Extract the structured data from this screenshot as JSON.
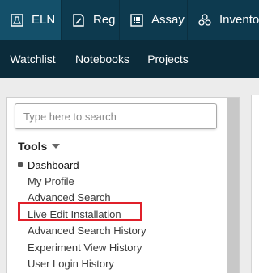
{
  "top_nav": {
    "tabs": [
      {
        "label": "ELN",
        "icon": "flask-book-icon",
        "active": true
      },
      {
        "label": "Reg",
        "icon": "register-pen-icon"
      },
      {
        "label": "Assay",
        "icon": "calculator-grid-icon"
      },
      {
        "label": "Invento",
        "icon": "molecule-cluster-icon"
      }
    ]
  },
  "sub_nav": {
    "tabs": [
      {
        "label": "Watchlist"
      },
      {
        "label": "Notebooks"
      },
      {
        "label": "Projects"
      }
    ]
  },
  "sidebar": {
    "search_placeholder": "Type here to search",
    "tools_heading": "Tools",
    "tools": [
      {
        "label": "Dashboard",
        "current": true
      },
      {
        "label": "My Profile"
      },
      {
        "label": "Advanced Search"
      },
      {
        "label": "Live Edit Installation",
        "highlighted": true
      },
      {
        "label": "Advanced Search History"
      },
      {
        "label": "Experiment View History"
      },
      {
        "label": "User Login History"
      }
    ]
  },
  "colors": {
    "topbar": "#0d3a4f",
    "subbar": "#0b2b3a",
    "highlight_box": "#e0202a"
  }
}
